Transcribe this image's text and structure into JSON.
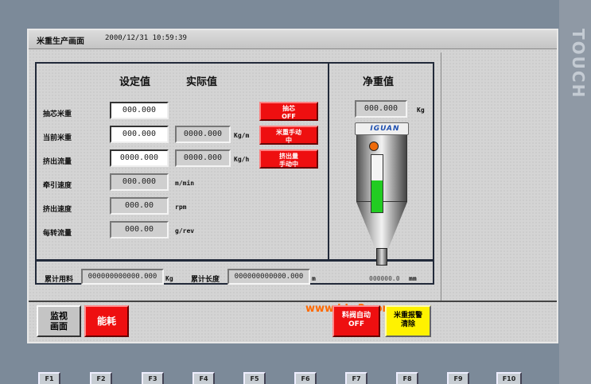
{
  "bezel": {
    "brand": "TOUCH"
  },
  "title": {
    "screen_name": "米重生产画面",
    "datetime": "2000/12/31 10:59:39"
  },
  "headers": {
    "setpoint": "设定值",
    "actual": "实际值",
    "net_weight": "净重值"
  },
  "rows": [
    {
      "label": "抽芯米重",
      "set": "000.000",
      "actual": "",
      "unit": ""
    },
    {
      "label": "当前米重",
      "set": "000.000",
      "actual": "0000.000",
      "unit": "Kg/m"
    },
    {
      "label": "挤出流量",
      "set": "0000.000",
      "actual": "0000.000",
      "unit": "Kg/h"
    },
    {
      "label": "牵引速度",
      "set": "",
      "actual": "000.000",
      "unit": "m/min"
    },
    {
      "label": "挤出速度",
      "set": "",
      "actual": "000.00",
      "unit": "rpm"
    },
    {
      "label": "每转流量",
      "set": "",
      "actual": "000.00",
      "unit": "g/rev"
    }
  ],
  "status_buttons": {
    "core_weight": {
      "line1": "抽芯",
      "line2": "OFF"
    },
    "weight_manual": {
      "line1": "米重手动",
      "line2": "中"
    },
    "extrude_manual": {
      "line1": "挤出量",
      "line2": "手动中"
    }
  },
  "net": {
    "value": "000.000",
    "unit": "Kg",
    "logo": "IGUAN",
    "level": 0.55
  },
  "totals": {
    "material_label": "累计用料",
    "material_value": "000000000000.000",
    "material_unit": "Kg",
    "length_label": "累计长度",
    "length_value": "000000000000.000",
    "length_unit": "m",
    "extra_value": "000000.0",
    "extra_unit": "mm"
  },
  "watermark": "www.jdw2.com",
  "bottom_buttons": {
    "monitor": {
      "line1": "监视",
      "line2": "画面"
    },
    "energy": "能耗",
    "valve_auto": {
      "line1": "料阀自动",
      "line2": "OFF"
    },
    "alarm_clear": {
      "line1": "米重报警",
      "line2": "清除"
    }
  },
  "fkeys": [
    "F1",
    "F2",
    "F3",
    "F4",
    "F5",
    "F6",
    "F7",
    "F8",
    "F9",
    "F10"
  ],
  "colors": {
    "alarm_red": "#ee0f10",
    "level_green": "#22cc22",
    "yellow": "#fff200"
  }
}
